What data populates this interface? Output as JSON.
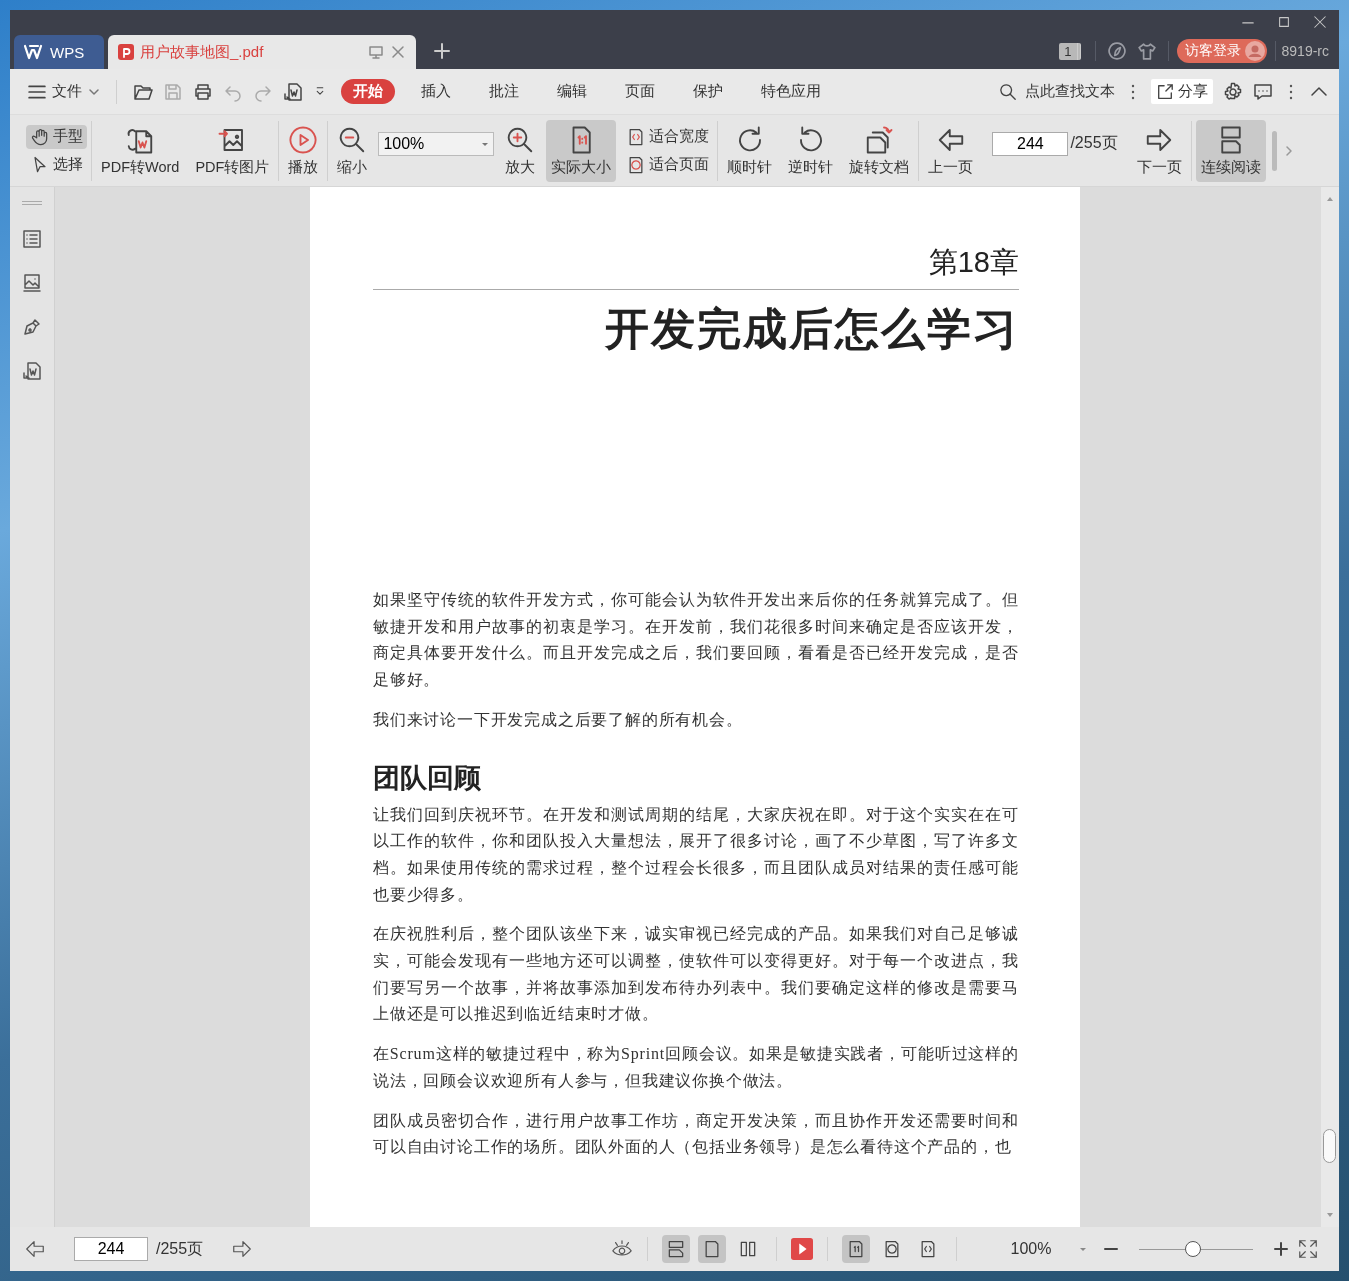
{
  "window": {
    "tabs": [
      {
        "kind": "home",
        "label": "WPS",
        "selected": false
      },
      {
        "kind": "document",
        "label": "用户故事地图_.pdf",
        "selected": true
      }
    ],
    "badge": "1",
    "login": "访客登录",
    "version": "8919-rc"
  },
  "menu": {
    "file": "文件",
    "tabs": [
      {
        "label": "开始",
        "selected": true
      },
      {
        "label": "插入",
        "selected": false
      },
      {
        "label": "批注",
        "selected": false
      },
      {
        "label": "编辑",
        "selected": false
      },
      {
        "label": "页面",
        "selected": false
      },
      {
        "label": "保护",
        "selected": false
      },
      {
        "label": "特色应用",
        "selected": false
      }
    ],
    "find_label": "点此查找文本",
    "share": "分享"
  },
  "toolbar": {
    "groups": [
      [
        {
          "kind": "stack",
          "items": [
            {
              "kind": "hand",
              "label": "手型",
              "selected": true
            },
            {
              "kind": "select",
              "label": "选择",
              "selected": false
            }
          ]
        }
      ],
      [
        {
          "kind": "pdf2word",
          "label": "PDF转Word"
        },
        {
          "kind": "pdf2img",
          "label": "PDF转图片"
        }
      ],
      [
        {
          "kind": "play",
          "label": "播放"
        }
      ],
      [
        {
          "kind": "zoom_out",
          "label": "缩小"
        },
        {
          "kind": "zoom_field",
          "value": "100%"
        },
        {
          "kind": "zoom_in",
          "label": "放大"
        },
        {
          "kind": "actual_size",
          "label": "实际大小",
          "selected": true
        },
        {
          "kind": "stack",
          "items": [
            {
              "kind": "fit_width",
              "label": "适合宽度",
              "selected": false
            },
            {
              "kind": "fit_page",
              "label": "适合页面",
              "selected": false
            }
          ]
        }
      ],
      [
        {
          "kind": "cw",
          "label": "顺时针"
        },
        {
          "kind": "ccw",
          "label": "逆时针"
        },
        {
          "kind": "rotate_doc",
          "label": "旋转文档"
        }
      ],
      [
        {
          "kind": "prev",
          "label": "上一页"
        },
        {
          "kind": "page_field",
          "value": "244",
          "total": "/255页"
        },
        {
          "kind": "next",
          "label": "下一页"
        }
      ],
      [
        {
          "kind": "continuous",
          "label": "连续阅读",
          "selected": true
        }
      ]
    ]
  },
  "document": {
    "chapter": "第18章",
    "title": "开发完成后怎么学习",
    "blocks": [
      {
        "kind": "paragraph",
        "text": "如果坚守传统的软件开发方式，你可能会认为软件开发出来后你的任务就算完成了。但敏捷开发和用户故事的初衷是学习。在开发前，我们花很多时间来确定是否应该开发，商定具体要开发什么。而且开发完成之后，我们要回顾，看看是否已经开发完成，是否足够好。"
      },
      {
        "kind": "paragraph",
        "text": "我们来讨论一下开发完成之后要了解的所有机会。"
      },
      {
        "kind": "heading",
        "text": "团队回顾"
      },
      {
        "kind": "paragraph",
        "text": "让我们回到庆祝环节。在开发和测试周期的结尾，大家庆祝在即。对于这个实实在在可以工作的软件，你和团队投入大量想法，展开了很多讨论，画了不少草图，写了许多文档。如果使用传统的需求过程，整个过程会长很多，而且团队成员对结果的责任感可能也要少得多。"
      },
      {
        "kind": "paragraph",
        "text": "在庆祝胜利后，整个团队该坐下来，诚实审视已经完成的产品。如果我们对自己足够诚实，可能会发现有一些地方还可以调整，使软件可以变得更好。对于每一个改进点，我们要写另一个故事，并将故事添加到发布待办列表中。我们要确定这样的修改是需要马上做还是可以推迟到临近结束时才做。"
      },
      {
        "kind": "paragraph",
        "text": "在Scrum这样的敏捷过程中，称为Sprint回顾会议。如果是敏捷实践者，可能听过这样的说法，回顾会议欢迎所有人参与，但我建议你换个做法。"
      },
      {
        "kind": "paragraph",
        "text": "团队成员密切合作，进行用户故事工作坊，商定开发决策，而且协作开发还需要时间和可以自由讨论工作的场所。团队外面的人（包括业务领导）是怎么看待这个产品的，也"
      }
    ]
  },
  "status_bar": {
    "page": "244",
    "total": "/255页",
    "view_modes": [
      {
        "selected": true
      },
      {
        "selected": true
      },
      {
        "selected": false
      }
    ],
    "fit_modes": [
      {
        "selected": true
      },
      {
        "selected": false
      },
      {
        "selected": false
      }
    ],
    "zoom": "100%",
    "zoom_slider": {
      "level": 0.47
    }
  }
}
